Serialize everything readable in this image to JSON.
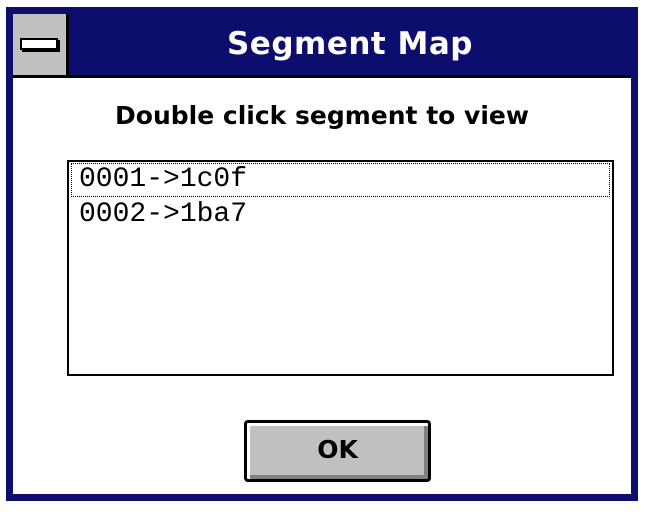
{
  "window": {
    "title": "Segment Map"
  },
  "dialog": {
    "prompt": "Double click segment to view",
    "segments": [
      "0001->1c0f",
      "0002->1ba7"
    ],
    "ok_label": "OK"
  },
  "icons": {
    "system_menu": "system-menu-icon"
  },
  "colors": {
    "title_bar": "#0d0d6e",
    "button_face": "#c0c0c0"
  }
}
